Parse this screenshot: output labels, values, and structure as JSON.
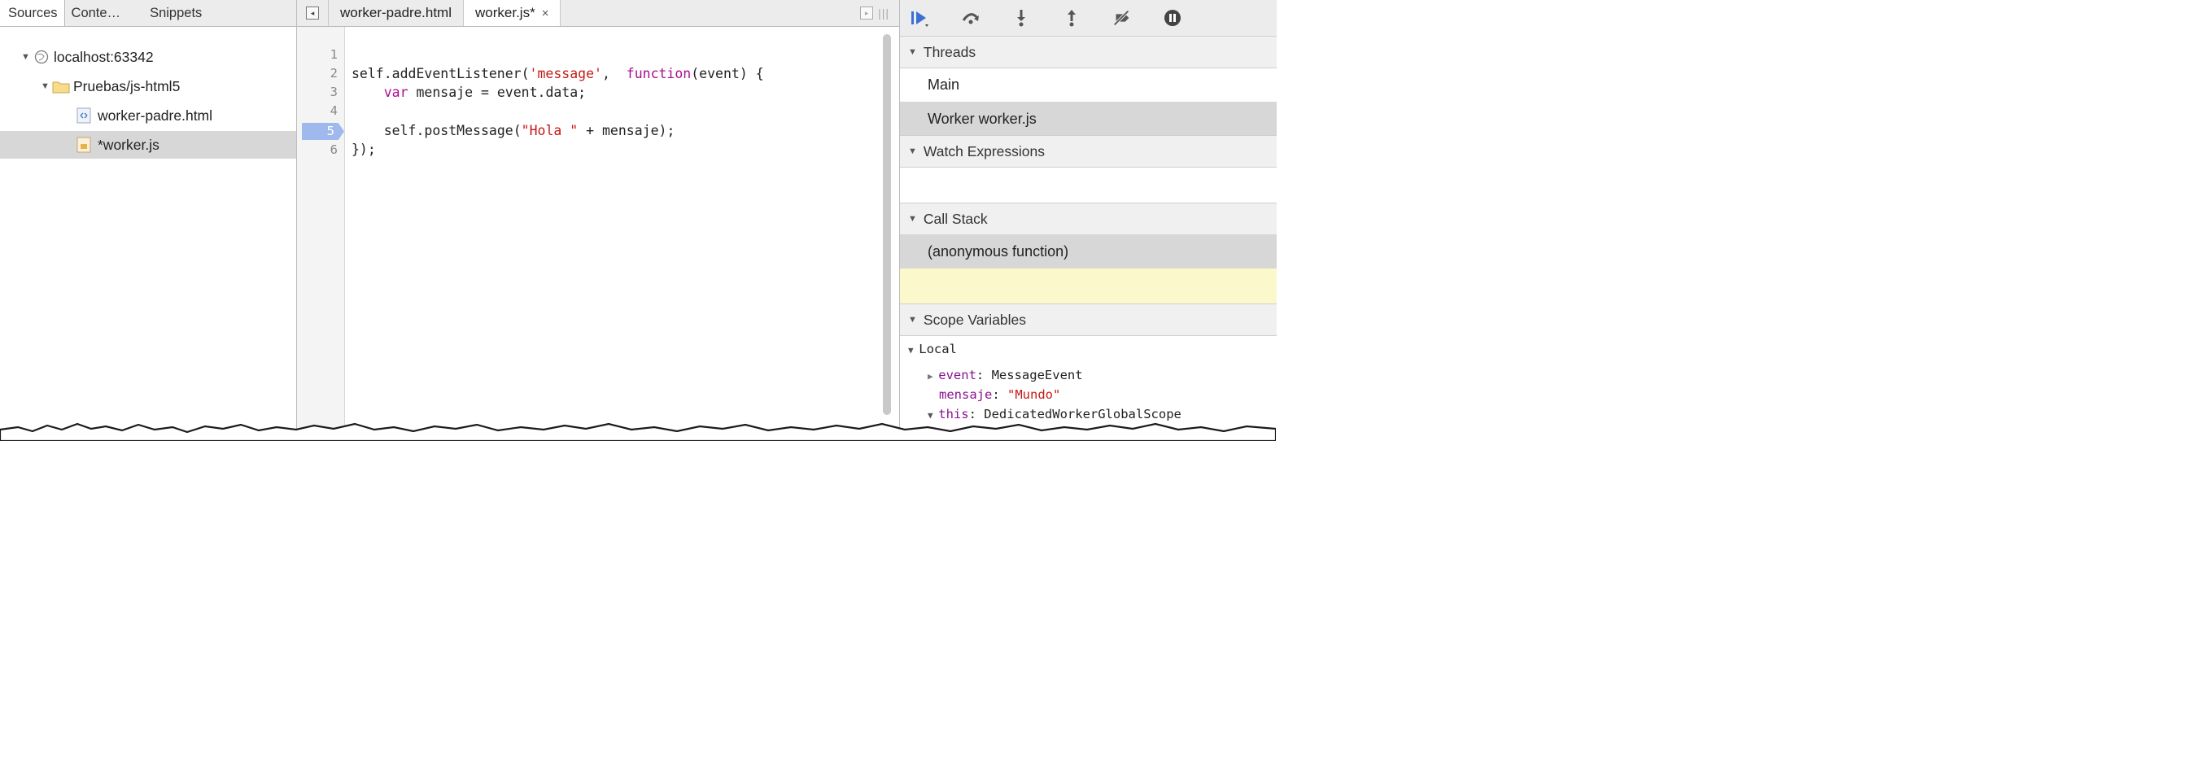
{
  "navigator": {
    "tabs": [
      "Sources",
      "Conte…",
      "Snippets"
    ],
    "tree": [
      {
        "label": "localhost:63342",
        "icon": "globe-icon",
        "level": 0
      },
      {
        "label": "Pruebas/js-html5",
        "icon": "folder-icon",
        "level": 1
      },
      {
        "label": "worker-padre.html",
        "icon": "html-file-icon",
        "level": 2
      },
      {
        "label": "*worker.js",
        "icon": "js-file-icon",
        "level": 2,
        "selected": true
      }
    ]
  },
  "editor": {
    "tabs": [
      {
        "label": "worker-padre.html",
        "active": false
      },
      {
        "label": "worker.js*",
        "active": true,
        "close": "×"
      }
    ],
    "line_numbers": [
      "1",
      "2",
      "3",
      "4",
      "5",
      "6"
    ],
    "breakpoint_line": "5",
    "code": {
      "l2_a": "self.addEventListener(",
      "l2_str": "'message'",
      "l2_b": ",  ",
      "l2_kw": "function",
      "l2_c": "(event) {",
      "l3_kw": "var",
      "l3_rest": " mensaje = event.data;",
      "l5_a": "self.postMessage(",
      "l5_str": "\"Hola \"",
      "l5_b": " + mensaje);",
      "l6": "});"
    }
  },
  "debugger": {
    "threads_label": "Threads",
    "threads": [
      "Main",
      "Worker worker.js"
    ],
    "watch_label": "Watch Expressions",
    "callstack_label": "Call Stack",
    "callstack": [
      "(anonymous function)"
    ],
    "scope_label": "Scope Variables",
    "scope": {
      "local_label": "Local",
      "event_name": "event",
      "event_value": "MessageEvent",
      "mensaje_name": "mensaje",
      "mensaje_value": "\"Mundo\"",
      "this_name": "this",
      "this_value": "DedicatedWorkerGlobalScope"
    }
  },
  "colors": {
    "keyword": "#aa0d91",
    "string": "#c41a16",
    "breakpoint": "#9fb9ec",
    "selected_row": "#d7d7d7",
    "callframe_highlight": "#fbf9cc",
    "toolbar_blue": "#3b6fd6"
  }
}
